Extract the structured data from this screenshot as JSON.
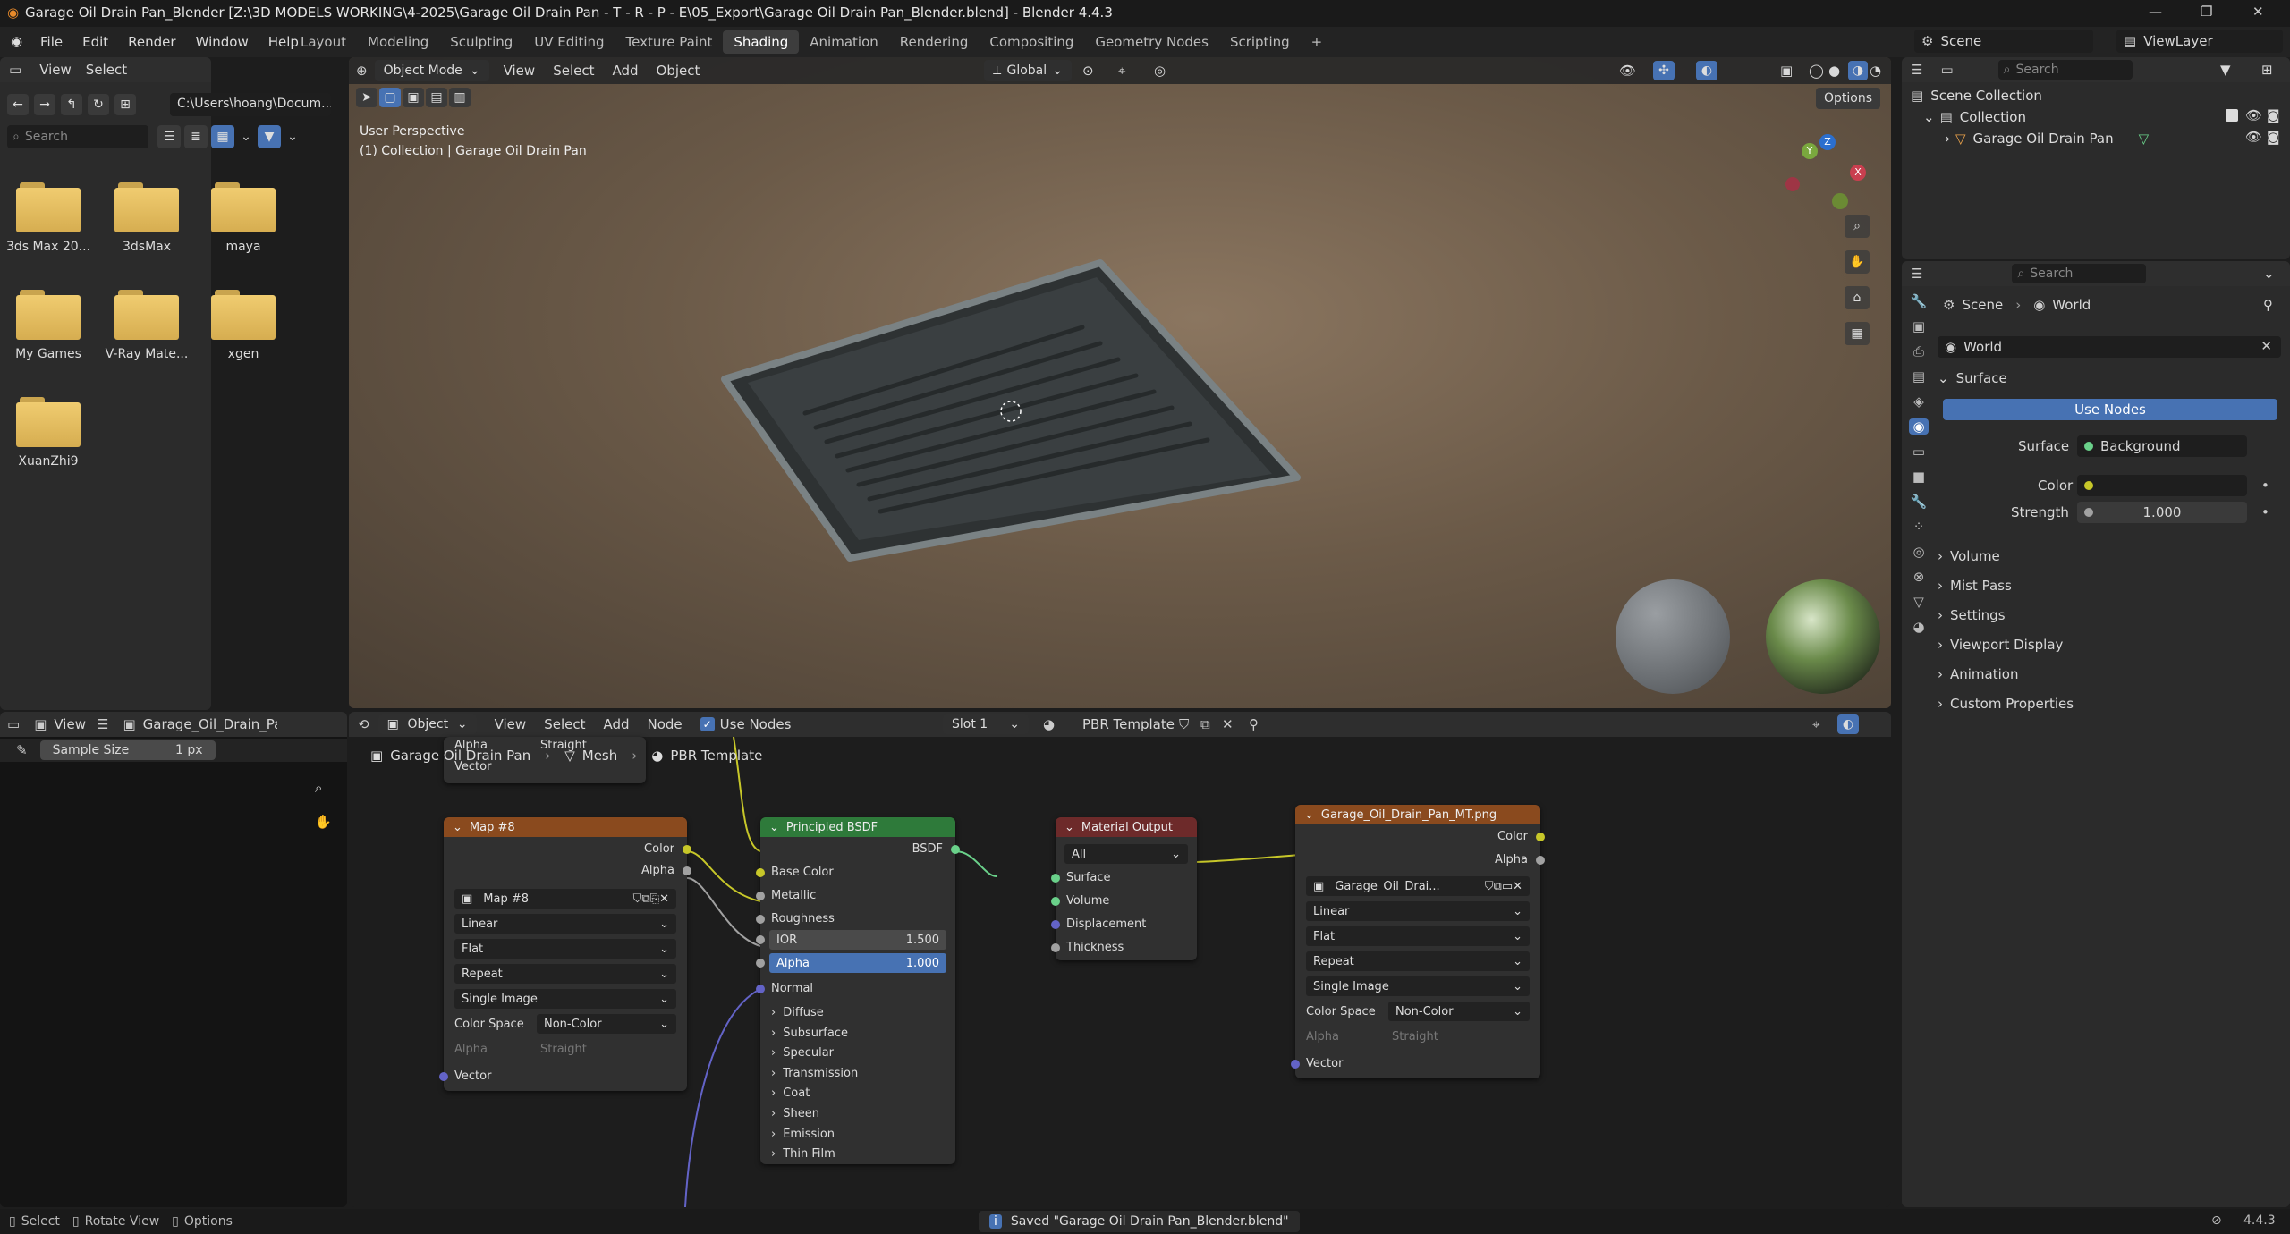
{
  "window": {
    "title": "Garage Oil Drain Pan_Blender [Z:\\3D MODELS WORKING\\4-2025\\Garage Oil Drain Pan - T - R - P - E\\05_Export\\Garage Oil Drain Pan_Blender.blend] - Blender 4.4.3"
  },
  "menu": [
    "File",
    "Edit",
    "Render",
    "Window",
    "Help"
  ],
  "workspaces": [
    "Layout",
    "Modeling",
    "Sculpting",
    "UV Editing",
    "Texture Paint",
    "Shading",
    "Animation",
    "Rendering",
    "Compositing",
    "Geometry Nodes",
    "Scripting"
  ],
  "active_workspace": "Shading",
  "scene": {
    "label": "Scene",
    "view_layer": "ViewLayer"
  },
  "file_browser": {
    "menus": [
      "View",
      "Select"
    ],
    "path": "C:\\Users\\hoang\\Docum...",
    "search_placeholder": "Search",
    "folders": [
      "3ds Max 20...",
      "3dsMax",
      "maya",
      "My Games",
      "V-Ray Mate...",
      "xgen",
      "XuanZhi9"
    ]
  },
  "viewport": {
    "mode": "Object Mode",
    "menus": [
      "View",
      "Select",
      "Add",
      "Object"
    ],
    "orientation": "Global",
    "options": "Options",
    "overlay_line1": "User Perspective",
    "overlay_line2": "(1) Collection | Garage Oil Drain Pan",
    "gizmo": {
      "x": "X",
      "y": "Y",
      "z": "Z"
    }
  },
  "outliner": {
    "search_placeholder": "Search",
    "items": [
      "Scene Collection",
      "Collection",
      "Garage Oil Drain Pan"
    ]
  },
  "properties": {
    "search_placeholder": "Search",
    "breadcrumb_scene": "Scene",
    "breadcrumb_world": "World",
    "world_name": "World",
    "surface_section": "Surface",
    "use_nodes": "Use Nodes",
    "surface_label": "Surface",
    "surface_value": "Background",
    "color_label": "Color",
    "strength_label": "Strength",
    "strength_value": "1.000",
    "sections": [
      "Volume",
      "Mist Pass",
      "Settings",
      "Viewport Display",
      "Animation",
      "Custom Properties"
    ]
  },
  "image_editor": {
    "menu": "View",
    "image_name": "Garage_Oil_Drain_Pan_",
    "sample_size_label": "Sample Size",
    "sample_size_value": "1 px"
  },
  "node_editor": {
    "object_label": "Object",
    "menus": [
      "View",
      "Select",
      "Add",
      "Node"
    ],
    "use_nodes": "Use Nodes",
    "slot": "Slot 1",
    "material": "PBR Template",
    "breadcrumb": [
      "Garage Oil Drain Pan",
      "Mesh",
      "PBR Template"
    ],
    "partial_node": {
      "alpha": "Alpha",
      "straight": "Straight",
      "vector": "Vector"
    },
    "map8": {
      "title": "Map #8",
      "out_color": "Color",
      "out_alpha": "Alpha",
      "image": "Map #8",
      "interp": "Linear",
      "proj": "Flat",
      "ext": "Repeat",
      "source": "Single Image",
      "cs_label": "Color Space",
      "cs_value": "Non-Color",
      "alpha_label": "Alpha",
      "alpha_value": "Straight",
      "vector": "Vector"
    },
    "bsdf": {
      "title": "Principled BSDF",
      "out": "BSDF",
      "inputs": [
        "Base Color",
        "Metallic",
        "Roughness"
      ],
      "ior_label": "IOR",
      "ior_value": "1.500",
      "alpha_label": "Alpha",
      "alpha_value": "1.000",
      "normal": "Normal",
      "panels": [
        "Diffuse",
        "Subsurface",
        "Specular",
        "Transmission",
        "Coat",
        "Sheen",
        "Emission",
        "Thin Film"
      ]
    },
    "matout": {
      "title": "Material Output",
      "target": "All",
      "inputs": [
        "Surface",
        "Volume",
        "Displacement",
        "Thickness"
      ]
    },
    "mt": {
      "title": "Garage_Oil_Drain_Pan_MT.png",
      "out_color": "Color",
      "out_alpha": "Alpha",
      "image": "Garage_Oil_Drai...",
      "interp": "Linear",
      "proj": "Flat",
      "ext": "Repeat",
      "source": "Single Image",
      "cs_label": "Color Space",
      "cs_value": "Non-Color",
      "alpha_label": "Alpha",
      "alpha_value": "Straight",
      "vector": "Vector"
    }
  },
  "statusbar": {
    "select": "Select",
    "rotate": "Rotate View",
    "options": "Options",
    "message": "Saved \"Garage Oil Drain Pan_Blender.blend\"",
    "version": "4.4.3"
  },
  "colors": {
    "accent": "#4772b3",
    "shader_green": "#2e7a3a",
    "texture_orange": "#8a4a1e",
    "output_red": "#6d2a2a",
    "socket_yellow": "#c7c729",
    "socket_grey": "#a1a1a1",
    "socket_purple": "#6363c7"
  }
}
